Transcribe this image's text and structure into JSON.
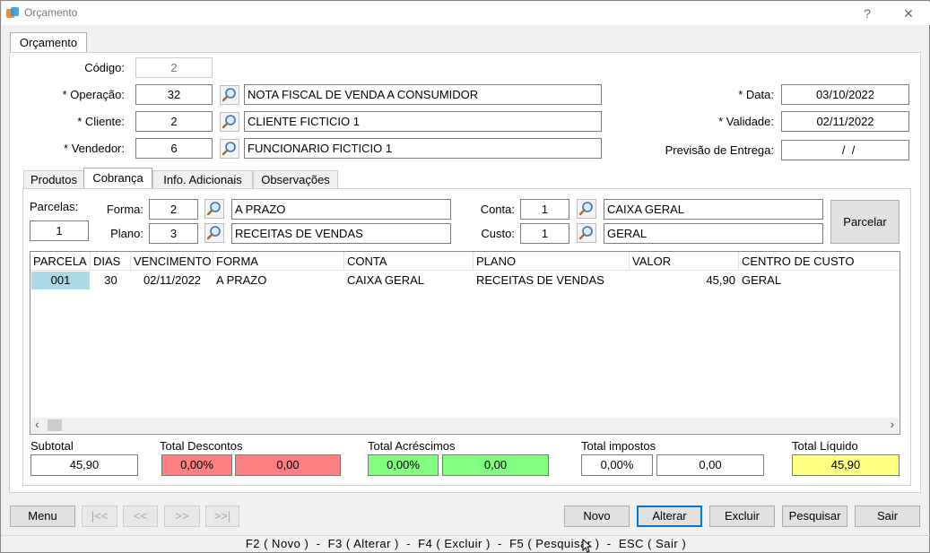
{
  "window": {
    "title": "Orçamento",
    "help": "?",
    "close": "✕"
  },
  "main_tab": "Orçamento",
  "header": {
    "codigo_label": "Código:",
    "codigo": "2",
    "operacao_label": "* Operação:",
    "operacao_code": "32",
    "operacao_desc": "NOTA FISCAL DE VENDA A CONSUMIDOR",
    "cliente_label": "* Cliente:",
    "cliente_code": "2",
    "cliente_desc": "CLIENTE FICTICIO 1",
    "vendedor_label": "* Vendedor:",
    "vendedor_code": "6",
    "vendedor_desc": "FUNCIONARIO FICTICIO 1",
    "data_label": "* Data:",
    "data": "03/10/2022",
    "validade_label": "* Validade:",
    "validade": "02/11/2022",
    "previsao_label": "Previsão de Entrega:",
    "previsao": "  /  /"
  },
  "tabs": [
    "Produtos",
    "Cobrança",
    "Info. Adicionais",
    "Observações"
  ],
  "cobranca": {
    "parcelas_label": "Parcelas:",
    "parcelas": "1",
    "forma_label": "Forma:",
    "forma_code": "2",
    "forma_desc": "A PRAZO",
    "plano_label": "Plano:",
    "plano_code": "3",
    "plano_desc": "RECEITAS DE VENDAS",
    "conta_label": "Conta:",
    "conta_code": "1",
    "conta_desc": "CAIXA GERAL",
    "custo_label": "Custo:",
    "custo_code": "1",
    "custo_desc": "GERAL",
    "parcelar_button": "Parcelar"
  },
  "grid": {
    "columns": [
      "PARCELA",
      "DIAS",
      "VENCIMENTO",
      "FORMA",
      "CONTA",
      "PLANO",
      "VALOR",
      "CENTRO DE CUSTO"
    ],
    "rows": [
      [
        "001",
        "30",
        "02/11/2022",
        "A PRAZO",
        "CAIXA GERAL",
        "RECEITAS DE VENDAS",
        "45,90",
        "GERAL"
      ]
    ],
    "scroll_left": "‹",
    "scroll_right": "›"
  },
  "totals": {
    "subtotal_label": "Subtotal",
    "subtotal": "45,90",
    "descontos_label": "Total Descontos",
    "descontos_pct": "0,00%",
    "descontos_val": "0,00",
    "acrescimos_label": "Total Acréscimos",
    "acrescimos_pct": "0,00%",
    "acrescimos_val": "0,00",
    "impostos_label": "Total impostos",
    "impostos_pct": "0,00%",
    "impostos_val": "0,00",
    "liquido_label": "Total Líquido",
    "liquido": "45,90"
  },
  "toolbar": {
    "menu": "Menu",
    "first": "|<<",
    "prev": "<<",
    "next": ">>",
    "last": ">>|",
    "novo": "Novo",
    "alterar": "Alterar",
    "excluir": "Excluir",
    "pesquisar": "Pesquisar",
    "sair": "Sair"
  },
  "shortcuts": "F2 ( Novo )  -  F3 ( Alterar )  -  F4 ( Excluir )  -  F5 ( Pesquisar )  -  ESC ( Sair )",
  "colors": {
    "desconto": "#ff8080",
    "acrescimo": "#80ff80",
    "liquido": "#ffff80",
    "selected": "#add8e6",
    "focus": "#0078d7"
  }
}
